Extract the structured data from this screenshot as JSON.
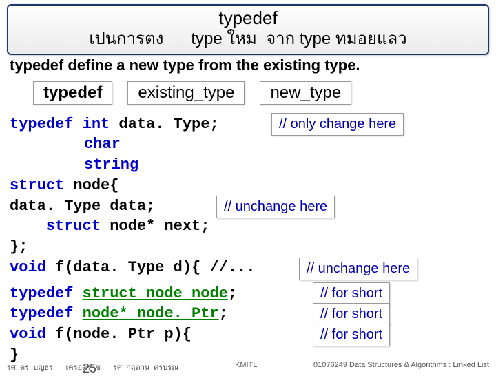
{
  "title": {
    "line1": "typedef",
    "line2": "เปนการตง      type ใหม  จาก type ทมอยแลว"
  },
  "subtitle": "typedef  define a new type from the existing type.",
  "syntax": {
    "kw": "typedef",
    "existing": "existing_type",
    "newt": "new_type"
  },
  "code1": {
    "l1a": "typedef ",
    "l1b": "int",
    "l1c": " data. Type;",
    "l2": "char",
    "l3": "string",
    "l4a": "struct ",
    "l4b": "node{",
    "l5": "   data. Type data;",
    "l6a": "   struct ",
    "l6b": "node* next;",
    "l7": "};",
    "l8a": "void ",
    "l8b": "f(data. Type d){ //..."
  },
  "code2": {
    "l1a": "typedef ",
    "l1b": "struct node node",
    "l1c": ";",
    "l2a": "typedef ",
    "l2b": "node* node. Ptr",
    "l2c": ";",
    "l3a": "void ",
    "l3b": "f(node. Ptr p){",
    "l4": "}"
  },
  "comments": {
    "c1": "// only change here",
    "c2": "// unchange here",
    "c3": "// unchange here",
    "s1": "// for short",
    "s2": "// for short",
    "s3": "// for short"
  },
  "footer": {
    "left": "รศ. ดร. บญธร      เครอตราช      รศ. กฤตวน  ศรบรณ",
    "mid": "KMITL",
    "right": "01076249 Data Structures & Algorithms  : Linked List"
  },
  "slide_num": "25"
}
